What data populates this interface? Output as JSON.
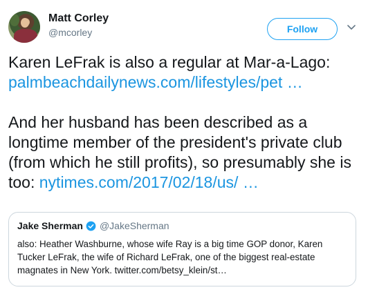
{
  "user": {
    "name": "Matt Corley",
    "handle": "@mcorley",
    "follow_label": "Follow"
  },
  "tweet": {
    "line1": "Karen LeFrak is also a regular at Mar-a-Lago:",
    "link1": "palmbeachdailynews.com/lifestyles/pet …",
    "para2_text": "And her husband has been described as a longtime member of the president's private club (from which he still profits), so presumably she is too: ",
    "link2": "nytimes.com/2017/02/18/us/ …"
  },
  "quote": {
    "name": "Jake Sherman",
    "handle": "@JakeSherman",
    "text": "also: Heather Washburne, whose wife Ray is a big time GOP donor, Karen Tucker LeFrak, the wife of Richard LeFrak, one of the biggest real-estate magnates in New York. twitter.com/betsy_klein/st…"
  },
  "colors": {
    "accent": "#1da1f2",
    "link": "#1b95e0",
    "secondary_text": "#657786",
    "border": "#ccd6dd"
  }
}
